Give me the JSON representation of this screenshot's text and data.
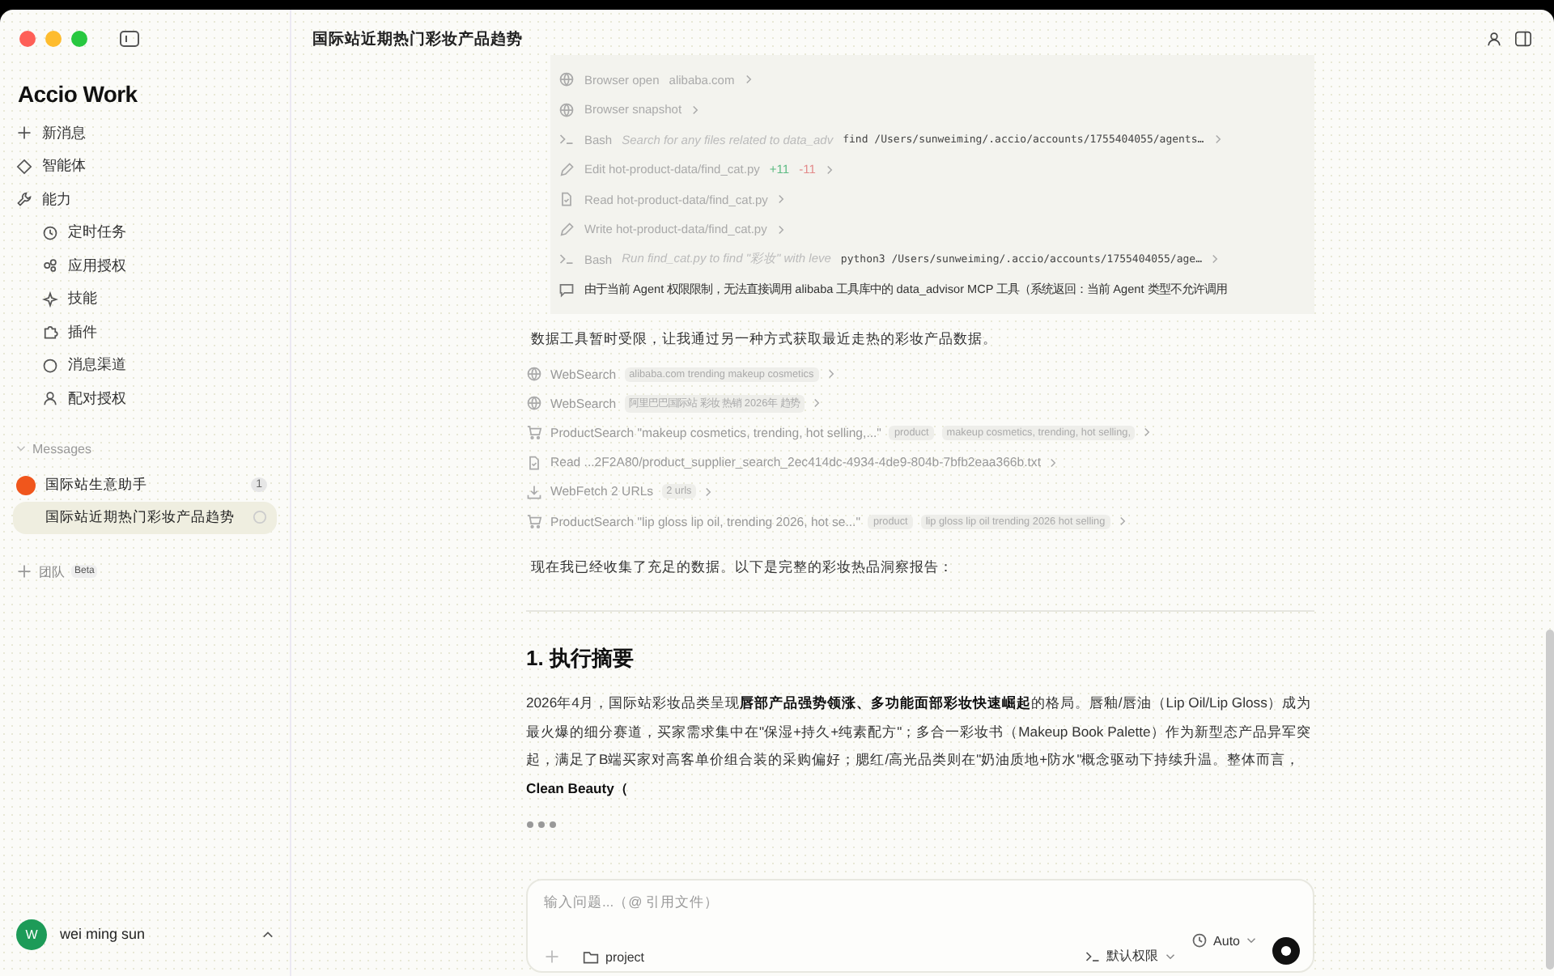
{
  "sidebar": {
    "logo": "Accio Work",
    "nav": [
      {
        "kind": "plus",
        "label": "新消息"
      },
      {
        "kind": "diamond",
        "label": "智能体"
      },
      {
        "kind": "wrench",
        "label": "能力",
        "children": [
          {
            "kind": "clock",
            "label": "定时任务"
          },
          {
            "kind": "link",
            "label": "应用授权"
          },
          {
            "kind": "spark",
            "label": "技能"
          },
          {
            "kind": "puzzle",
            "label": "插件"
          },
          {
            "kind": "circle",
            "label": "消息渠道"
          },
          {
            "kind": "user",
            "label": "配对授权"
          }
        ]
      }
    ],
    "messages": {
      "title": "Messages",
      "expanded": true,
      "items": [
        {
          "label": "国际站生意助手",
          "avatar": true,
          "badge": "1",
          "selected": false
        },
        {
          "label": "国际站近期热门彩妆产品趋势",
          "avatar": false,
          "busy": true,
          "selected": true
        }
      ]
    },
    "team": {
      "label": "团队",
      "badge": "Beta"
    },
    "user": {
      "initial": "W",
      "name": "wei ming sun"
    }
  },
  "header": {
    "title": "国际站近期热门彩妆产品趋势"
  },
  "tool_log": [
    {
      "kind": "globe",
      "name": "Browser open",
      "detail": "alibaba.com"
    },
    {
      "kind": "globe",
      "name": "Browser snapshot"
    },
    {
      "kind": "bash",
      "name": "Bash",
      "detail": "Search for any files related to data_adv",
      "code": "find /Users/sunweiming/.accio/accounts/1755404055/agents…"
    },
    {
      "kind": "edit",
      "name": "Edit hot-product-data/find_cat.py",
      "added": "+11",
      "removed": "-11"
    },
    {
      "kind": "read",
      "name": "Read hot-product-data/find_cat.py"
    },
    {
      "kind": "edit",
      "name": "Write hot-product-data/find_cat.py"
    },
    {
      "kind": "bash",
      "name": "Bash",
      "detail": "Run find_cat.py to find \"彩妆\" with leve",
      "code": "python3 /Users/sunweiming/.accio/accounts/1755404055/age…"
    },
    {
      "kind": "message",
      "name": "由于当前 Agent 权限限制，无法直接调用 alibaba 工具库中的 data_advisor MCP 工具（系统返回：当前 Agent 类型不允许调用"
    }
  ],
  "intro": "数据工具暂时受限，让我通过另一种方式获取最近走热的彩妆产品数据。",
  "tool_calls": [
    {
      "kind": "globe",
      "name": "WebSearch",
      "tags": [
        "alibaba.com trending makeup cosmetics"
      ]
    },
    {
      "kind": "globe",
      "name": "WebSearch",
      "tags": [
        "阿里巴巴国际站 彩妆 热销 2026年 趋势"
      ]
    },
    {
      "kind": "cart",
      "name": "ProductSearch \"makeup cosmetics, trending, hot selling,...\"",
      "tags": [
        "product",
        "makeup cosmetics, trending, hot selling,"
      ]
    },
    {
      "kind": "read",
      "name": "Read ...2F2A80/product_supplier_search_2ec414dc-4934-4de9-804b-7bfb2eaa366b.txt"
    },
    {
      "kind": "download",
      "name": "WebFetch 2 URLs",
      "tags": [
        "2 urls"
      ]
    },
    {
      "kind": "cart",
      "name": "ProductSearch \"lip gloss lip oil, trending 2026, hot se...\"",
      "tags": [
        "product",
        "lip gloss lip oil trending 2026 hot selling"
      ]
    }
  ],
  "summary_intro": "现在我已经收集了充足的数据。以下是完整的彩妆热品洞察报告：",
  "report": {
    "heading": "1. 执行摘要",
    "paragraph": "2026年4月，国际站彩妆品类呈现**唇部产品强势领涨、多功能面部彩妆快速崛起**的格局。唇釉/唇油（Lip Oil/Lip Gloss）成为最火爆的细分赛道，买家需求集中在\"保湿+持久+纯素配方\"；多合一彩妆书（Makeup Book Palette）作为新型态产品异军突起，满足了B端买家对高客单价组合装的采购偏好；腮红/高光品类则在\"奶油质地+防水\"概念驱动下持续升温。整体而言，**Clean Beauty（**",
    "generating": true
  },
  "composer": {
    "placeholder": "输入问题...（@ 引用文件）",
    "folder": "project",
    "permission": "默认权限",
    "mode": "Auto",
    "running": true
  }
}
